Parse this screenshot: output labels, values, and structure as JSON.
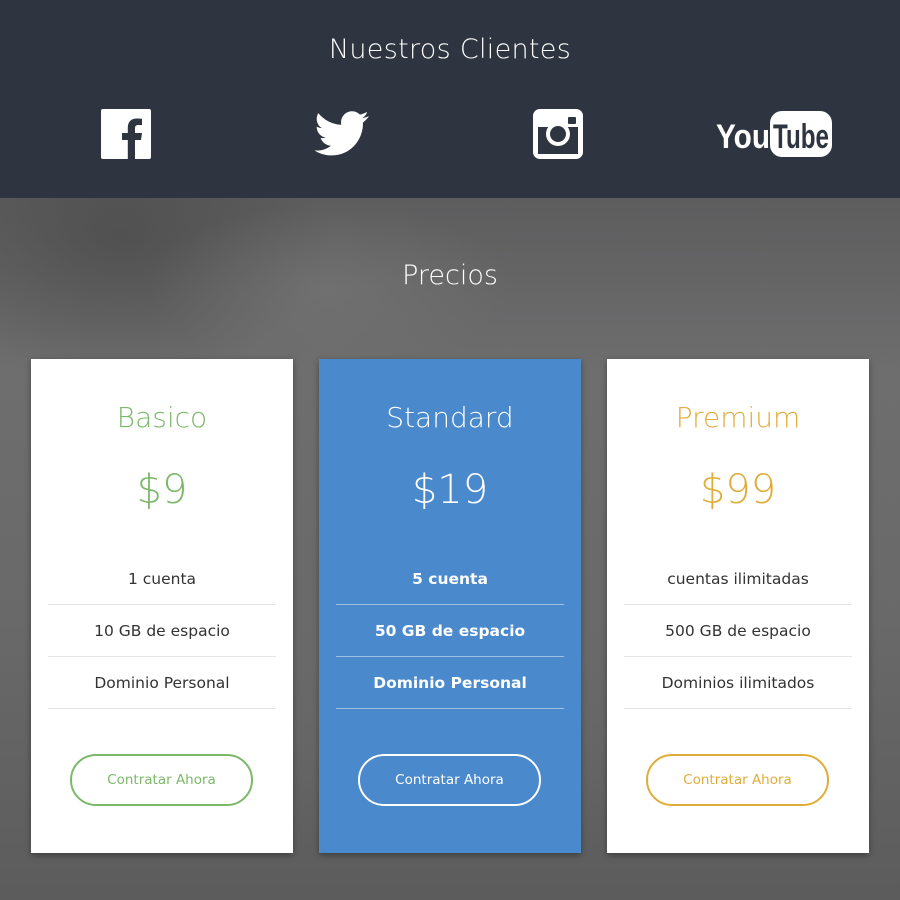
{
  "clients": {
    "title": "Nuestros Clientes",
    "logos": [
      {
        "name": "facebook-logo",
        "icon": "facebook-icon"
      },
      {
        "name": "twitter-logo",
        "icon": "twitter-icon"
      },
      {
        "name": "instagram-logo",
        "icon": "instagram-icon"
      },
      {
        "name": "youtube-logo",
        "icon": "youtube-icon",
        "text_you": "You",
        "text_tube": "Tube"
      }
    ]
  },
  "pricing": {
    "title": "Precios",
    "plans": [
      {
        "name": "Basico",
        "price": "$9",
        "accent": "#7cb86a",
        "features": [
          "1 cuenta",
          "10 GB de espacio",
          "Dominio Personal"
        ],
        "cta": "Contratar Ahora"
      },
      {
        "name": "Standard",
        "price": "$19",
        "accent": "#ffffff",
        "background": "#4a89cc",
        "features": [
          "5 cuenta",
          "50 GB de espacio",
          "Dominio Personal"
        ],
        "cta": "Contratar Ahora"
      },
      {
        "name": "Premium",
        "price": "$99",
        "accent": "#e0ad3a",
        "features": [
          "cuentas ilimitadas",
          "500 GB de espacio",
          "Dominios ilimitados"
        ],
        "cta": "Contratar Ahora"
      }
    ]
  },
  "colors": {
    "header_bg": "#2f3540",
    "featured_bg": "#4a89cc",
    "basic_accent": "#7cb86a",
    "premium_accent": "#e0ad3a"
  }
}
